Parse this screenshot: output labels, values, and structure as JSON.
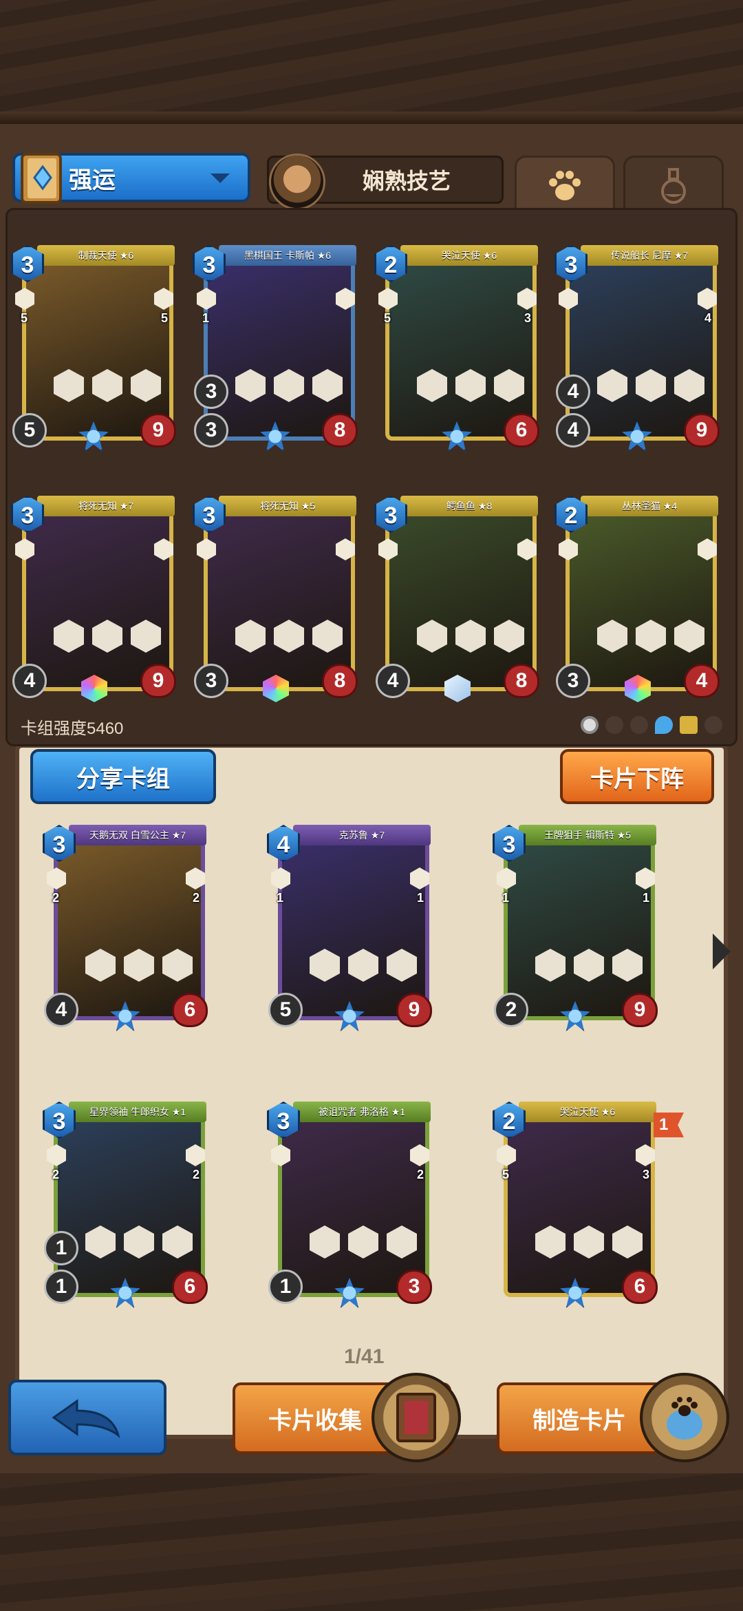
{
  "header": {
    "deck_name": "强运",
    "hero_skill": "娴熟技艺"
  },
  "deck_cards": [
    {
      "name": "制裁天使 ★6",
      "cost": "3",
      "left": "5",
      "right": "5",
      "atk": "5",
      "hp": "9",
      "frame": "gold"
    },
    {
      "name": "黑棋国王 卡斯帕 ★6",
      "cost": "3",
      "left": "1",
      "right": "",
      "atk": "3",
      "atk2": "3",
      "hp": "8",
      "frame": "blue"
    },
    {
      "name": "哭泣天使 ★6",
      "cost": "2",
      "left": "5",
      "right": "3",
      "atk": "",
      "hp": "6",
      "frame": "gold"
    },
    {
      "name": "传说船长 尼摩 ★7",
      "cost": "3",
      "left": "",
      "right": "4",
      "atk": "4",
      "atk2": "4",
      "hp": "9",
      "frame": "gold"
    },
    {
      "name": "将死无知 ★7",
      "cost": "3",
      "left": "",
      "right": "",
      "atk": "4",
      "hp": "9",
      "frame": "gold"
    },
    {
      "name": "将死无知 ★5",
      "cost": "3",
      "left": "",
      "right": "",
      "atk": "3",
      "hp": "8",
      "frame": "gold"
    },
    {
      "name": "鳄鱼鱼 ★8",
      "cost": "3",
      "left": "",
      "right": "",
      "atk": "4",
      "hp": "8",
      "frame": "gold"
    },
    {
      "name": "丛林圣猫 ★4",
      "cost": "2",
      "left": "",
      "right": "",
      "atk": "3",
      "hp": "4",
      "frame": "gold"
    }
  ],
  "deck_strength": "卡组强度5460",
  "buttons": {
    "share": "分享卡组",
    "unequip": "卡片下阵",
    "collect": "卡片收集",
    "craft": "制造卡片"
  },
  "collection_cards": [
    {
      "name": "天鹅无双 白雪公主 ★7",
      "cost": "3",
      "left": "2",
      "right": "2",
      "atk": "4",
      "hp": "6",
      "frame": "purple"
    },
    {
      "name": "克苏鲁 ★7",
      "cost": "4",
      "left": "1",
      "right": "1",
      "atk": "5",
      "hp": "9",
      "frame": "purple"
    },
    {
      "name": "王牌狙手 辑斯特 ★5",
      "cost": "3",
      "left": "1",
      "right": "1",
      "atk": "2",
      "hp": "9",
      "frame": "green"
    },
    {
      "name": "星界领袖 牛郎织女 ★1",
      "cost": "3",
      "left": "2",
      "right": "2",
      "atk": "1",
      "atk2": "1",
      "hp": "6",
      "frame": "green"
    },
    {
      "name": "被诅咒者 弗洛格 ★1",
      "cost": "3",
      "left": "",
      "right": "2",
      "atk": "1",
      "hp": "3",
      "frame": "green"
    },
    {
      "name": "哭泣天使 ★6",
      "cost": "2",
      "left": "5",
      "right": "3",
      "atk": "",
      "hp": "6",
      "frame": "gold"
    }
  ],
  "collection_flag": "1",
  "pager": "1/41",
  "colors": {
    "blue_button": "#2f8ee0",
    "orange_button": "#f08a30",
    "panel": "#3d2c22",
    "parchment": "#e8dcc4"
  }
}
